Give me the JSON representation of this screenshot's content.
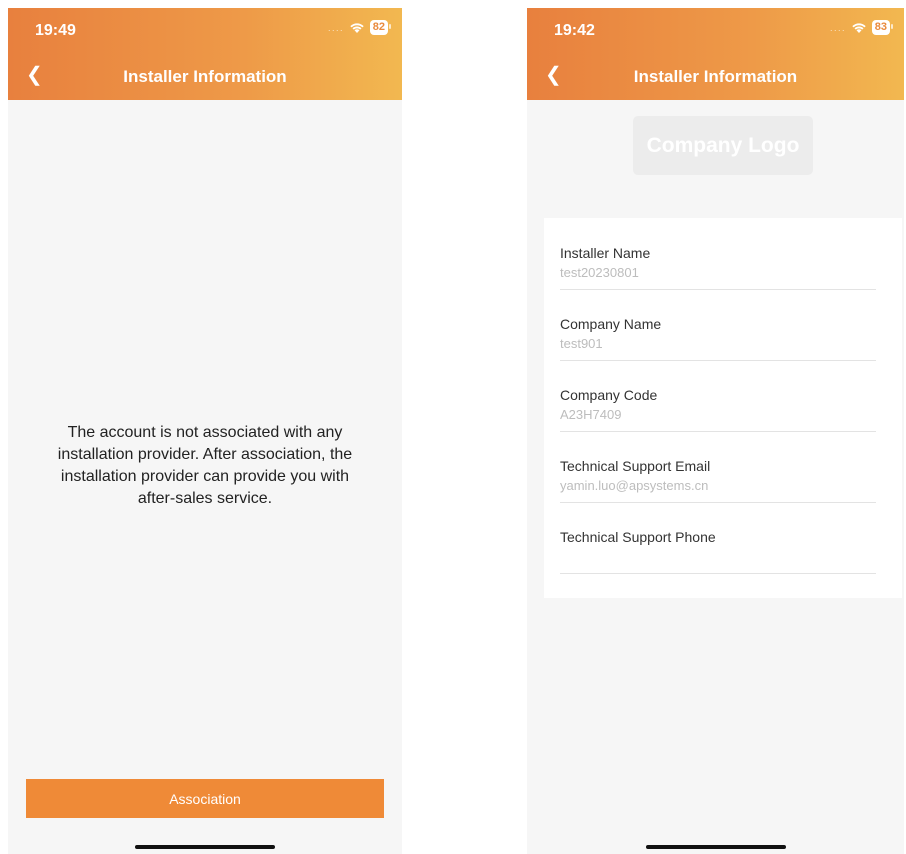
{
  "left_screen": {
    "status": {
      "time": "19:49",
      "battery": "82"
    },
    "header": {
      "title": "Installer Information"
    },
    "message": "The account is not associated with any installation provider. After association, the installation provider can provide you with after-sales service.",
    "association_button": "Association"
  },
  "right_screen": {
    "status": {
      "time": "19:42",
      "battery": "83"
    },
    "header": {
      "title": "Installer Information"
    },
    "logo_placeholder": "Company Logo",
    "fields": [
      {
        "label": "Installer Name",
        "value": "test20230801"
      },
      {
        "label": "Company Name",
        "value": "test901"
      },
      {
        "label": "Company Code",
        "value": "A23H7409"
      },
      {
        "label": "Technical Support Email",
        "value": "yamin.luo@apsystems.cn"
      },
      {
        "label": "Technical Support Phone",
        "value": ""
      }
    ]
  },
  "colors": {
    "accent": "#ef8a37",
    "header_gradient_end": "#f2b850"
  }
}
